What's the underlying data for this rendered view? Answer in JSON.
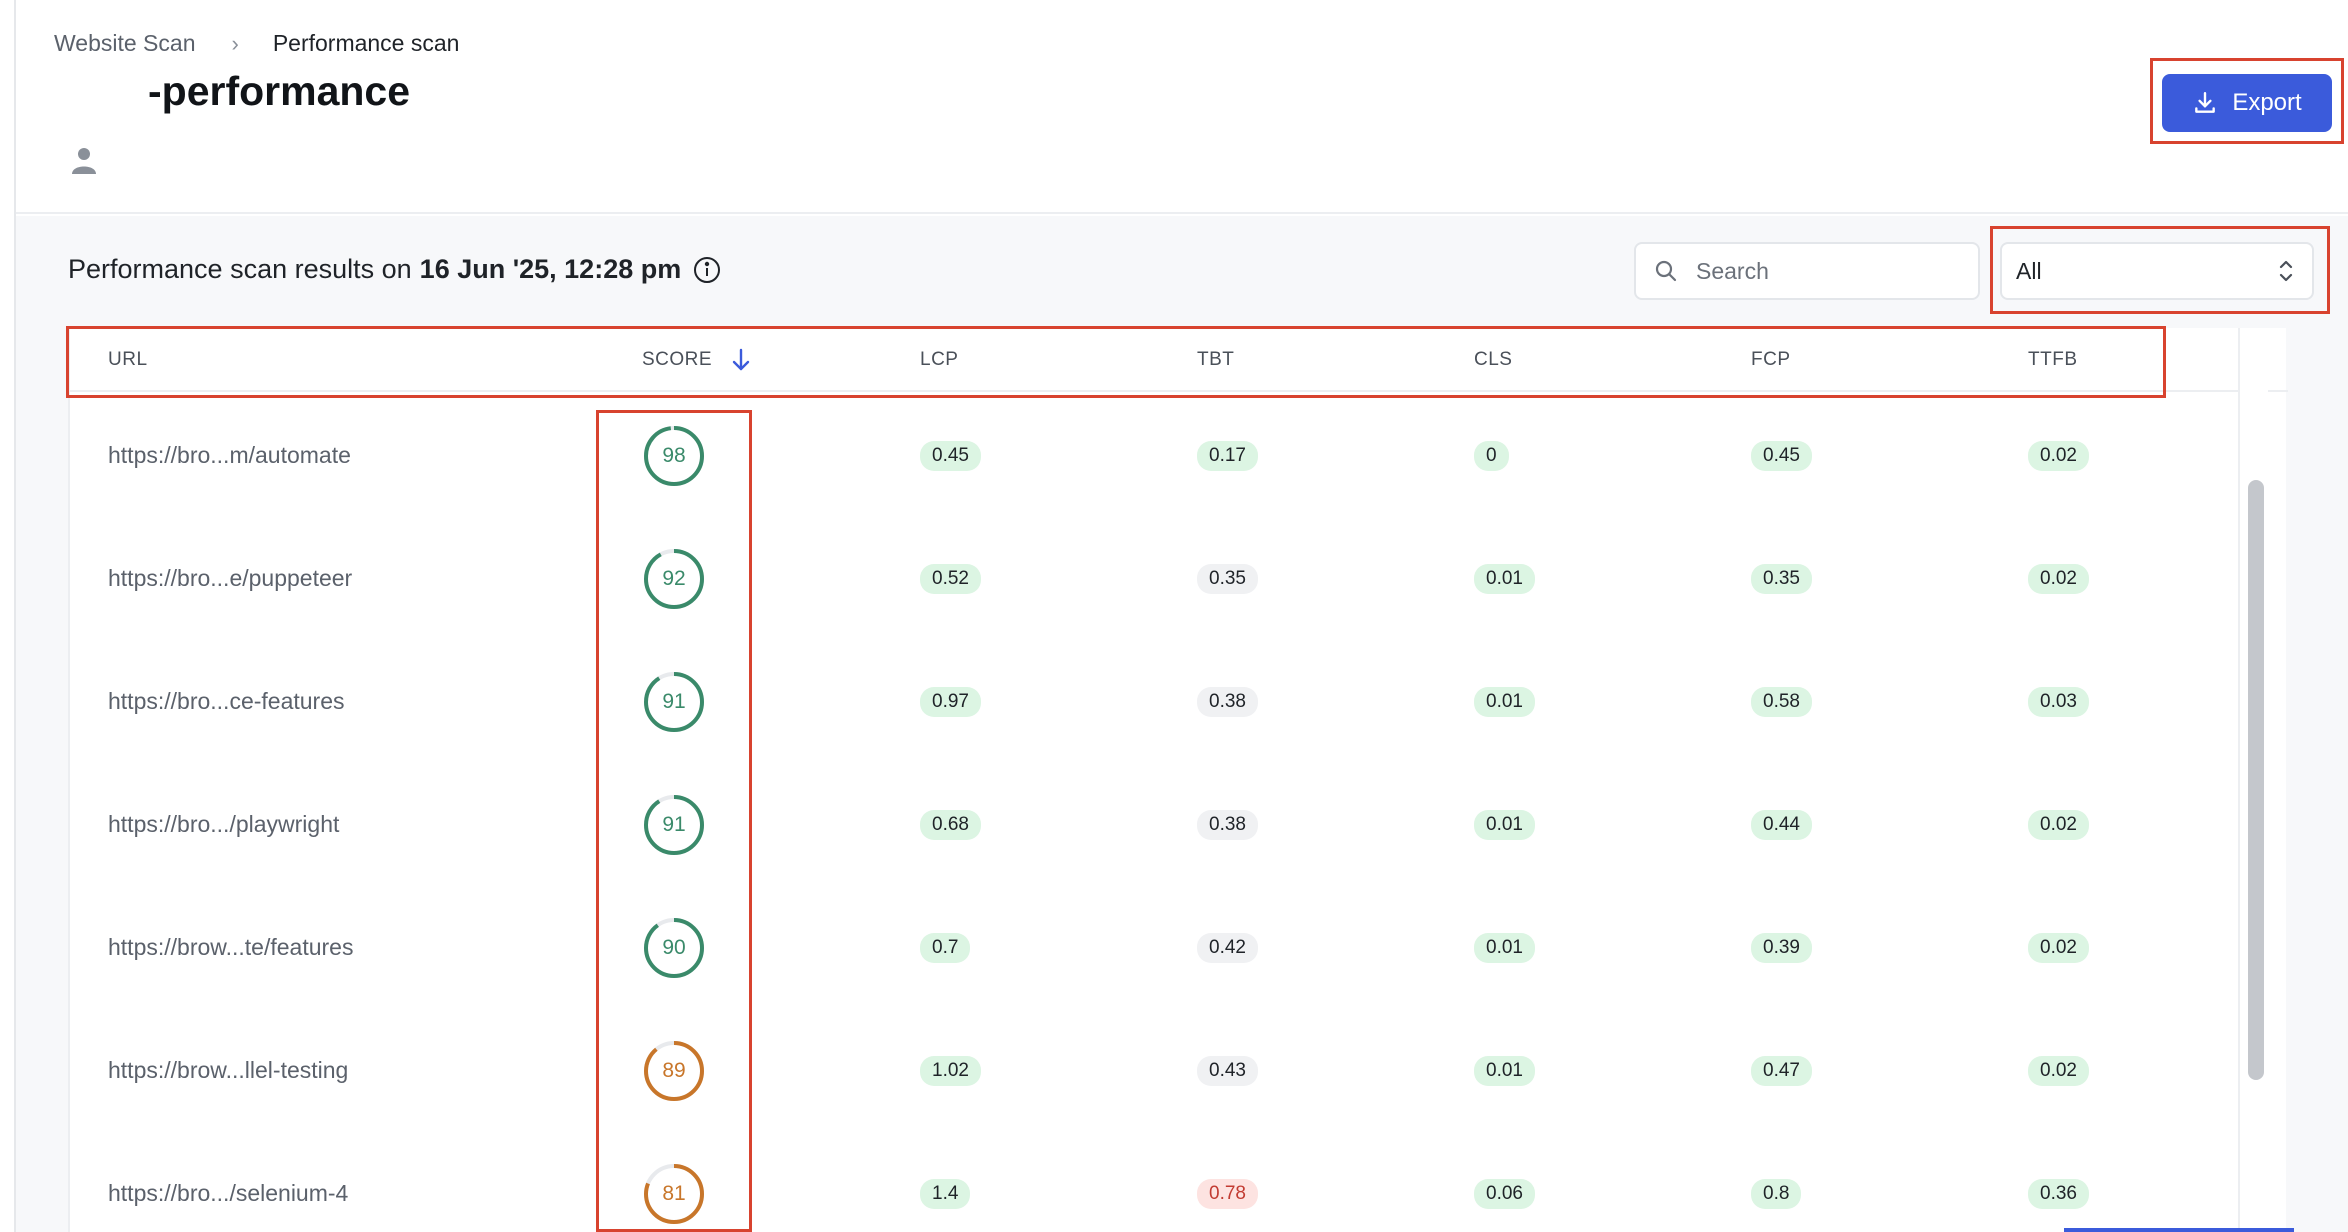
{
  "breadcrumb": {
    "parent": "Website Scan",
    "separator": "›",
    "current": "Performance scan"
  },
  "page_title": "-performance",
  "export_label": "Export",
  "results": {
    "prefix": "Performance scan results on",
    "date": "16 Jun '25, 12:28 pm"
  },
  "search": {
    "placeholder": "Search",
    "value": ""
  },
  "filter": {
    "selected": "All"
  },
  "columns": [
    "URL",
    "SCORE",
    "LCP",
    "TBT",
    "CLS",
    "FCP",
    "TTFB"
  ],
  "sort": {
    "column": "SCORE",
    "direction": "descending"
  },
  "colors": {
    "accent": "#3b5bdb",
    "score_good": "#3a8a6a",
    "score_average": "#c8762a",
    "pill_good": "#dcf5e3",
    "pill_neutral": "#f0f1f3",
    "pill_poor": "#fde3e1"
  },
  "rows": [
    {
      "url": "https://bro...m/automate",
      "score": 98,
      "score_status": "good",
      "lcp": "0.45",
      "lcp_s": "good",
      "tbt": "0.17",
      "tbt_s": "good",
      "cls": "0",
      "cls_s": "good",
      "fcp": "0.45",
      "fcp_s": "good",
      "ttfb": "0.02",
      "ttfb_s": "good"
    },
    {
      "url": "https://bro...e/puppeteer",
      "score": 92,
      "score_status": "good",
      "lcp": "0.52",
      "lcp_s": "good",
      "tbt": "0.35",
      "tbt_s": "mid",
      "cls": "0.01",
      "cls_s": "good",
      "fcp": "0.35",
      "fcp_s": "good",
      "ttfb": "0.02",
      "ttfb_s": "good"
    },
    {
      "url": "https://bro...ce-features",
      "score": 91,
      "score_status": "good",
      "lcp": "0.97",
      "lcp_s": "good",
      "tbt": "0.38",
      "tbt_s": "mid",
      "cls": "0.01",
      "cls_s": "good",
      "fcp": "0.58",
      "fcp_s": "good",
      "ttfb": "0.03",
      "ttfb_s": "good"
    },
    {
      "url": "https://bro.../playwright",
      "score": 91,
      "score_status": "good",
      "lcp": "0.68",
      "lcp_s": "good",
      "tbt": "0.38",
      "tbt_s": "mid",
      "cls": "0.01",
      "cls_s": "good",
      "fcp": "0.44",
      "fcp_s": "good",
      "ttfb": "0.02",
      "ttfb_s": "good"
    },
    {
      "url": "https://brow...te/features",
      "score": 90,
      "score_status": "good",
      "lcp": "0.7",
      "lcp_s": "good",
      "tbt": "0.42",
      "tbt_s": "mid",
      "cls": "0.01",
      "cls_s": "good",
      "fcp": "0.39",
      "fcp_s": "good",
      "ttfb": "0.02",
      "ttfb_s": "good"
    },
    {
      "url": "https://brow...llel-testing",
      "score": 89,
      "score_status": "average",
      "lcp": "1.02",
      "lcp_s": "good",
      "tbt": "0.43",
      "tbt_s": "mid",
      "cls": "0.01",
      "cls_s": "good",
      "fcp": "0.47",
      "fcp_s": "good",
      "ttfb": "0.02",
      "ttfb_s": "good"
    },
    {
      "url": "https://bro.../selenium-4",
      "score": 81,
      "score_status": "average",
      "lcp": "1.4",
      "lcp_s": "good",
      "tbt": "0.78",
      "tbt_s": "bad",
      "cls": "0.06",
      "cls_s": "good",
      "fcp": "0.8",
      "fcp_s": "good",
      "ttfb": "0.36",
      "ttfb_s": "good"
    }
  ]
}
